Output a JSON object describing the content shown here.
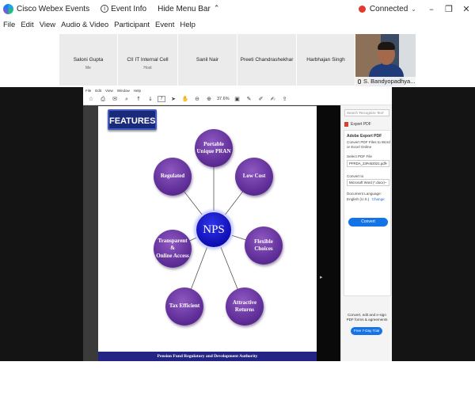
{
  "titlebar": {
    "app_title": "Cisco Webex Events",
    "event_info": "Event Info",
    "hide_menu_bar": "Hide Menu Bar",
    "status": "Connected",
    "status_color": "#e23b2e"
  },
  "menu": [
    "File",
    "Edit",
    "View",
    "Audio & Video",
    "Participant",
    "Event",
    "Help"
  ],
  "participants": [
    {
      "name": "Saloni Gupta",
      "role": "Me"
    },
    {
      "name": "CII IT Internal Cell",
      "role": "Host"
    },
    {
      "name": "Sanil Nair",
      "role": ""
    },
    {
      "name": "Preeti Chandrashekhar",
      "role": ""
    },
    {
      "name": "Harbhajan Singh",
      "role": ""
    }
  ],
  "active_speaker": "S. Bandyopadhya...",
  "acrobat": {
    "menu": [
      "File",
      "Edit",
      "View",
      "Window",
      "Help"
    ],
    "page_number": "7",
    "zoom": "37.6%"
  },
  "slide": {
    "heading": "FEATURES",
    "center": "NPS",
    "features": [
      "Portable\nUnique PRAN",
      "Low Cost",
      "Flexible\nChoices",
      "Attractive\nReturns",
      "Tax Efficient",
      "Transparent\n&\nOnline Access",
      "Regulated"
    ],
    "footer": "Pension Fund Regulatory and Development Authority",
    "node_color": "#62309a",
    "center_color": "#1010b8"
  },
  "tools_pane": {
    "search_placeholder": "Search 'Recognize Text'",
    "export_label": "Export PDF",
    "panel_title": "Adobe Export PDF",
    "panel_desc": "Convert PDF Files to Word or Excel Online",
    "select_label": "Select PDF File",
    "file_name": "PFRDA_23Feb2021.pdf",
    "convert_to_label": "Convert to",
    "convert_to_value": "Microsoft Word (*.docx)",
    "doc_language_label": "Document Language:",
    "doc_language_value": "English (U.S.)",
    "change_label": "Change",
    "convert_button": "Convert",
    "promo_text": "Convert, edit and e-sign PDF forms & agreements",
    "trial_button": "Free 7-Day Trial"
  }
}
